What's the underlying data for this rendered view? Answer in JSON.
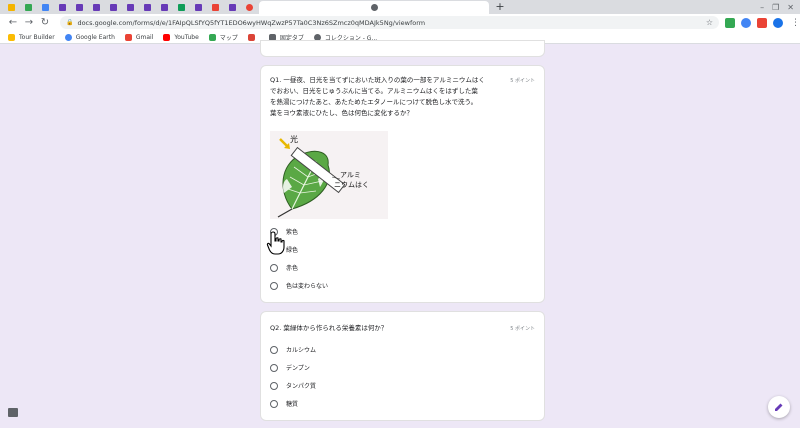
{
  "browser": {
    "url": "docs.google.com/forms/d/e/1FAIpQLSfYQ5fYT1EDO6wyHWqZwzP57Ta0C3Nz6SZmcz0qMDAJk5Ng/viewform",
    "bookmarks": [
      {
        "label": "Tour Builder",
        "color": "#fbbc04"
      },
      {
        "label": "Google Earth",
        "color": "#4285f4"
      },
      {
        "label": "Gmail",
        "color": "#ea4335"
      },
      {
        "label": "YouTube",
        "color": "#ff0000"
      },
      {
        "label": "マップ",
        "color": "#34a853"
      },
      {
        "label": "",
        "color": "#db4437"
      },
      {
        "label": "固定タブ",
        "color": "#5f6368"
      },
      {
        "label": "コレクション - G...",
        "color": "#5f6368"
      }
    ],
    "colors": {
      "chrome_bg": "#dadce0",
      "page_bg": "#ede7f6",
      "accent": "#673ab7"
    }
  },
  "form": {
    "q1": {
      "text_lines": [
        "Q1. 一昼夜、日光を当てずにおいた斑入りの葉の一部をアルミニウムはく",
        "でおおい、日光をじゅうぶんに当てる。アルミニウムはくをはずした葉",
        "を熱湯につけたあと、あたためたエタノールにつけて脱色し水で洗う。",
        "葉をヨウ素液にひたし、色は何色に変化するか？"
      ],
      "points": "5 ポイント",
      "figure": {
        "label_light": "光",
        "label_foil_1": "アルミ",
        "label_foil_2": "ニウムはく"
      },
      "options": [
        "紫色",
        "緑色",
        "赤色",
        "色は変わらない"
      ]
    },
    "q2": {
      "text": "Q2. 葉緑体から作られる栄養素は何か？",
      "points": "5 ポイント",
      "options": [
        "カルシウム",
        "デンプン",
        "タンパク質",
        "糖質"
      ]
    }
  }
}
